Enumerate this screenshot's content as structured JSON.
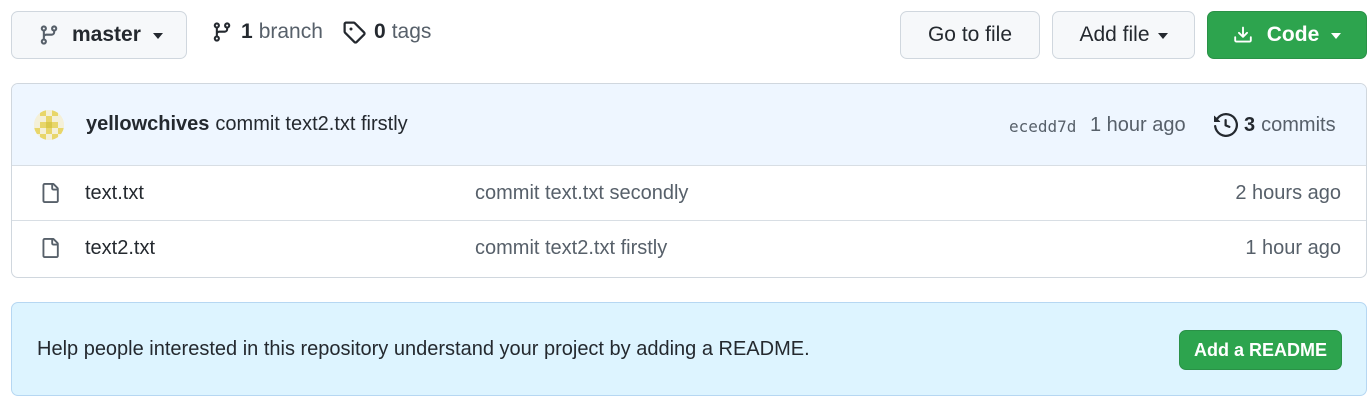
{
  "toolbar": {
    "branch_name": "master",
    "branches_count": "1",
    "branches_label": "branch",
    "tags_count": "0",
    "tags_label": "tags",
    "goto_file_label": "Go to file",
    "add_file_label": "Add file",
    "code_label": "Code"
  },
  "latest_commit": {
    "author": "yellowchives",
    "message": "commit text2.txt firstly",
    "sha": "ecedd7d",
    "time": "1 hour ago",
    "commits_count": "3",
    "commits_label": "commits"
  },
  "files": [
    {
      "name": "text.txt",
      "commit_message": "commit text.txt secondly",
      "age": "2 hours ago"
    },
    {
      "name": "text2.txt",
      "commit_message": "commit text2.txt firstly",
      "age": "1 hour ago"
    }
  ],
  "readme_prompt": {
    "message": "Help people interested in this repository understand your project by adding a README.",
    "button_label": "Add a README"
  },
  "colors": {
    "primary_green": "#2da44e",
    "commit_bar_bg": "#eef6ff",
    "readme_banner_bg": "#ddf4ff"
  }
}
